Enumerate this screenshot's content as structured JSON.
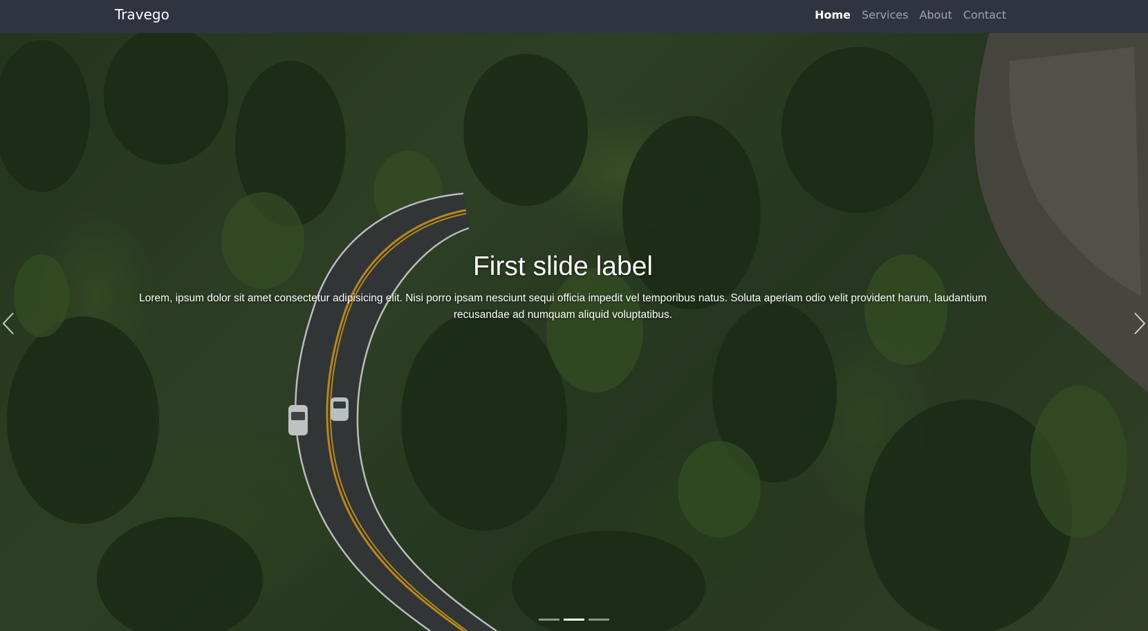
{
  "navbar": {
    "brand": "Travego",
    "links": [
      {
        "label": "Home",
        "active": true
      },
      {
        "label": "Services",
        "active": false
      },
      {
        "label": "About",
        "active": false
      },
      {
        "label": "Contact",
        "active": false
      }
    ]
  },
  "carousel": {
    "slide": {
      "title": "First slide label",
      "text": "Lorem, ipsum dolor sit amet consectetur adipisicing elit. Nisi porro ipsam nesciunt sequi officia impedit vel temporibus natus. Soluta aperiam odio velit provident harum, laudantium recusandae ad numquam aliquid voluptatibus."
    },
    "indicator_count": 3,
    "active_indicator": 2,
    "prev_icon": "chevron-left-icon",
    "next_icon": "chevron-right-icon"
  },
  "colors": {
    "navbar_bg": "#2f3440",
    "road": "#3a3c40",
    "road_center_line": "#e0a21b"
  }
}
